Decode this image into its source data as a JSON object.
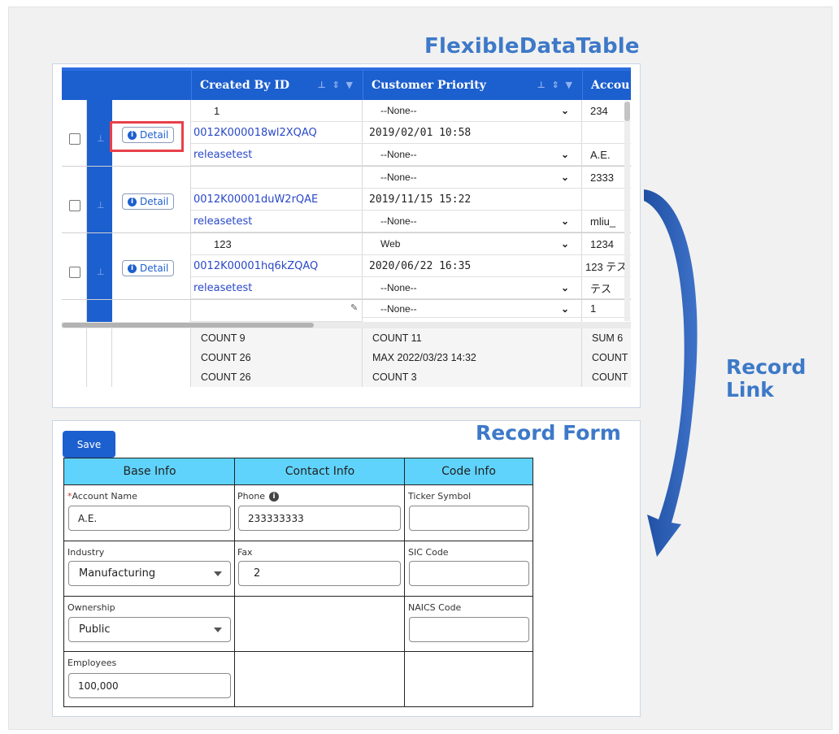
{
  "captions": {
    "table": "FlexibleDataTable",
    "form": "Record Form",
    "link_line1": "Record",
    "link_line2": "Link"
  },
  "table": {
    "columns": {
      "created_by_id": "Created By ID",
      "customer_priority": "Customer Priority",
      "account": "Accou"
    },
    "detail_label": "Detail",
    "records": [
      {
        "top_value": "1",
        "top_priority": "--None--",
        "top_account": "234",
        "id": "0012K000018wl2XQAQ",
        "date": "2019/02/01 10:58",
        "owner": "releasetest",
        "bottom_priority": "--None--",
        "bottom_account": "A.E."
      },
      {
        "top_value": "",
        "top_priority": "--None--",
        "top_account": "2333",
        "id": "0012K00001duW2rQAE",
        "date": "2019/11/15 15:22",
        "owner": "releasetest",
        "bottom_priority": "--None--",
        "bottom_account": "mliu_"
      },
      {
        "top_value": "123",
        "top_priority": "Web",
        "top_account": "1234",
        "id": "0012K00001hq6kZQAQ",
        "date": "2020/06/22 16:35",
        "account_extra": "123 テス",
        "owner": "releasetest",
        "bottom_priority": "--None--",
        "bottom_account": "テス"
      }
    ],
    "partial_row": {
      "priority": "--None--",
      "account": "1"
    },
    "summary": [
      {
        "created": "COUNT 9",
        "priority": "COUNT 11",
        "account": "SUM 6"
      },
      {
        "created": "COUNT 26",
        "priority": "MAX 2022/03/23 14:32",
        "account": "COUNT"
      },
      {
        "created": "COUNT 26",
        "priority": "COUNT 3",
        "account": "COUNT"
      }
    ]
  },
  "form": {
    "save_label": "Save",
    "sections": [
      "Base Info",
      "Contact Info",
      "Code Info"
    ],
    "fields": {
      "account_name": {
        "label": "Account Name",
        "value": "A.E."
      },
      "phone": {
        "label": "Phone",
        "value": "233333333"
      },
      "ticker_symbol": {
        "label": "Ticker Symbol",
        "value": ""
      },
      "industry": {
        "label": "Industry",
        "value": "Manufacturing"
      },
      "fax": {
        "label": "Fax",
        "value": "2"
      },
      "sic_code": {
        "label": "SIC Code",
        "value": ""
      },
      "ownership": {
        "label": "Ownership",
        "value": "Public"
      },
      "naics_code": {
        "label": "NAICS Code",
        "value": ""
      },
      "employees": {
        "label": "Employees",
        "value": "100,000"
      }
    }
  },
  "colors": {
    "accent": "#1c5fcf",
    "caption": "#3d79c8",
    "section_header": "#5fd3fb",
    "highlight": "#e8404a",
    "arrow": "#1e4fa3"
  }
}
